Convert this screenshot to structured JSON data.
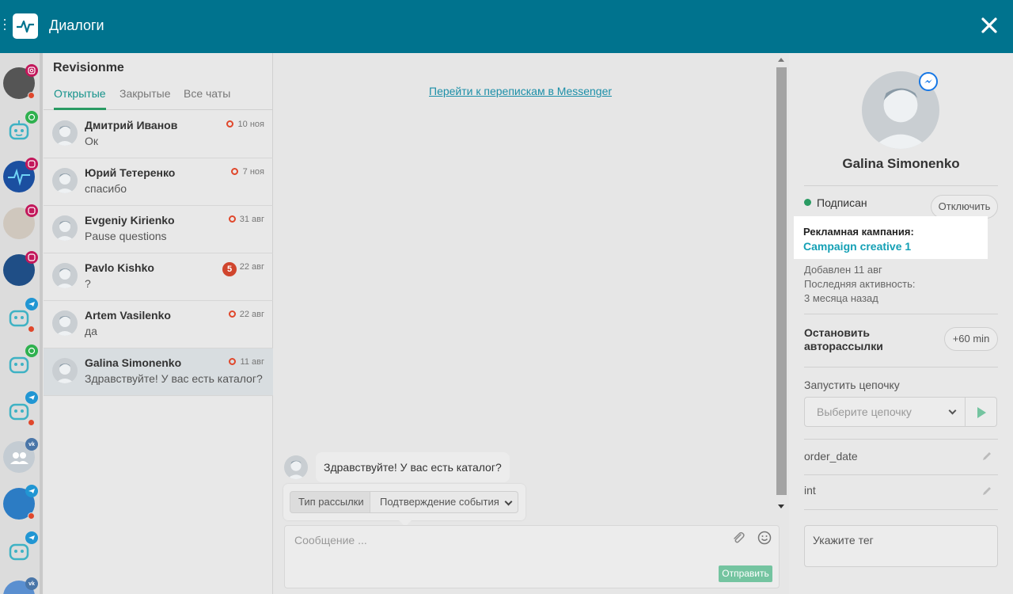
{
  "header": {
    "title": "Диалоги"
  },
  "conversations": {
    "account": "Revisionme",
    "tabs": [
      "Открытые",
      "Закрытые",
      "Все чаты"
    ],
    "items": [
      {
        "name": "Дмитрий Иванов",
        "message": "Ок",
        "date": "10 ноя",
        "unread": ""
      },
      {
        "name": "Юрий Тетеренко",
        "message": "спасибо",
        "date": "7 ноя",
        "unread": ""
      },
      {
        "name": "Evgeniy Kirienko",
        "message": "Pause questions",
        "date": "31 авг",
        "unread": ""
      },
      {
        "name": "Pavlo Kishko",
        "message": "?",
        "date": "22 авг",
        "unread": "5"
      },
      {
        "name": "Artem Vasilenko",
        "message": "да",
        "date": "22 авг",
        "unread": ""
      },
      {
        "name": "Galina Simonenko",
        "message": "Здравствуйте! У вас есть каталог?",
        "date": "11 авг",
        "unread": ""
      }
    ]
  },
  "chat": {
    "messenger_link": "Перейти к перепискам в Messenger",
    "last_message": "Здравствуйте! У вас есть каталог?",
    "mailing_type_label": "Тип рассылки",
    "mailing_type_value": "Подтверждение события",
    "composer_placeholder": "Сообщение ...",
    "send_label": "Отправить"
  },
  "profile": {
    "name": "Galina Simonenko",
    "status": "Подписан",
    "unsubscribe_label": "Отключить",
    "campaign_label": "Рекламная кампания:",
    "campaign_value": "Campaign creative 1",
    "added": "Добавлен 11 авг",
    "last_activity_label": "Последняя активность:",
    "last_activity_value": "3 месяца назад",
    "stop_mailing_line1": "Остановить",
    "stop_mailing_line2": "авторассылки",
    "stop_mailing_btn": "+60 min",
    "chain_label": "Запустить цепочку",
    "chain_placeholder": "Выберите цепочку",
    "field1": "order_date",
    "field2": "int",
    "tag_placeholder": "Укажите тег"
  },
  "colors": {
    "header": "#00738e",
    "accent_green": "#2a9b63",
    "link": "#1c8fa8",
    "badge_red": "#e0472b"
  },
  "icons": [
    "menu-dots-icon",
    "app-logo-icon",
    "close-icon",
    "instagram-icon",
    "whatsapp-icon",
    "telegram-icon",
    "vk-icon",
    "messenger-icon",
    "attach-icon",
    "emoji-icon",
    "play-icon",
    "pencil-icon",
    "chevron-down-icon"
  ]
}
